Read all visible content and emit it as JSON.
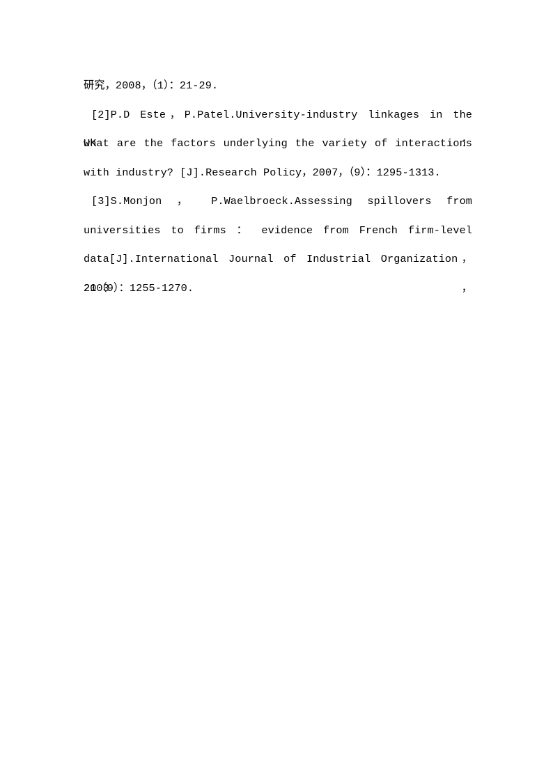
{
  "document": {
    "page_background": "#ffffff",
    "text_color": "#000000",
    "section": "references",
    "entries": [
      {
        "marker": "",
        "id": "reference-1-tail",
        "lines": [
          "研究，2008，（1）：21-29."
        ]
      },
      {
        "marker": "[2]",
        "id": "reference-2",
        "lines": [
          "[2]P.D Este，P.Patel.University-industry linkages in the UK：",
          "what are the factors underlying the variety of interactions",
          "with industry? [J].Research Policy，2007，（9）：1295-1313."
        ],
        "authors": "P.D Este，P.Patel",
        "title": "University-industry linkages in the UK：what are the factors underlying the variety of interactions with industry?",
        "doc_type": "[J]",
        "journal": "Research Policy",
        "year": "2007",
        "issue": "（9）",
        "pages": "1295-1313"
      },
      {
        "marker": "[3]",
        "id": "reference-3",
        "lines": [
          "[3]S.Monjon ，  P.Waelbroeck.Assessing  spillovers  from",
          "universities  to  firms ：  evidence  from  French  firm-level",
          "data[J].International Journal of Industrial Organization，2003，",
          "21（9）：1255-1270."
        ],
        "authors": "S.Monjon，P.Waelbroeck",
        "title": "Assessing spillovers from universities to firms：evidence from French firm-level data",
        "doc_type": "[J]",
        "journal": "International Journal of Industrial Organization",
        "year": "2003",
        "volume": "21",
        "issue": "（9）",
        "pages": "1255-1270"
      }
    ]
  }
}
